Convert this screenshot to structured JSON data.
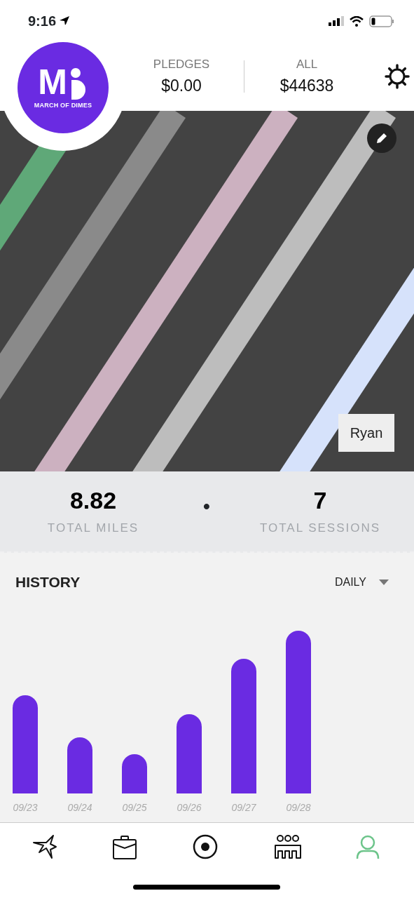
{
  "status_bar": {
    "time": "9:16"
  },
  "header": {
    "logo": {
      "mark": "M",
      "caption": "MARCH OF DIMES"
    },
    "stats": [
      {
        "label": "PLEDGES",
        "value": "$0.00"
      },
      {
        "label": "ALL",
        "value": "$44638"
      }
    ]
  },
  "profile": {
    "name": "Ryan"
  },
  "totals": [
    {
      "value": "8.82",
      "label": "TOTAL MILES"
    },
    {
      "value": "7",
      "label": "TOTAL SESSIONS"
    }
  ],
  "separator": "•",
  "history": {
    "title": "HISTORY",
    "period": "DAILY",
    "dates": [
      "09/23",
      "09/24",
      "09/25",
      "09/26",
      "09/27",
      "09/28"
    ]
  },
  "tabs": [
    {
      "kind": "burst",
      "selected": false
    },
    {
      "kind": "briefcase",
      "selected": false
    },
    {
      "kind": "record",
      "selected": false
    },
    {
      "kind": "team",
      "selected": false
    },
    {
      "kind": "profile",
      "selected": true
    }
  ]
}
